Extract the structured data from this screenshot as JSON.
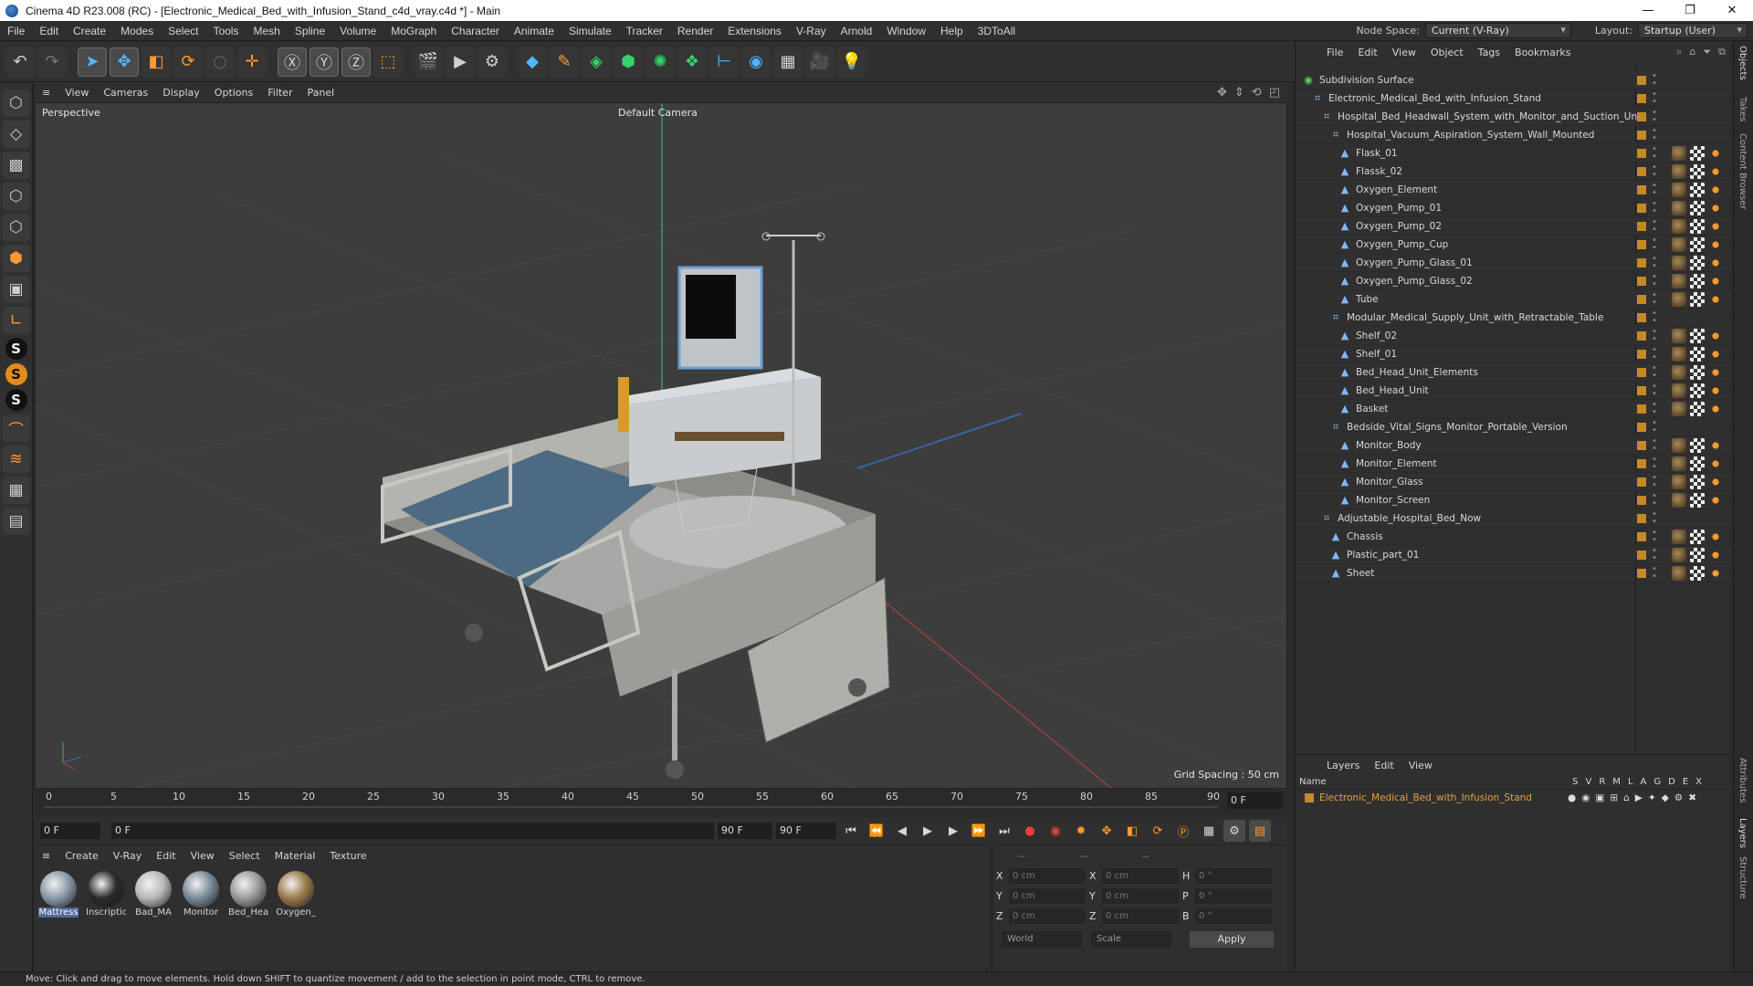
{
  "window": {
    "title": "Cinema 4D R23.008 (RC) - [Electronic_Medical_Bed_with_Infusion_Stand_c4d_vray.c4d *] - Main",
    "controls": [
      "—",
      "❐",
      "✕"
    ]
  },
  "menubar": {
    "items": [
      "File",
      "Edit",
      "Create",
      "Modes",
      "Select",
      "Tools",
      "Mesh",
      "Spline",
      "Volume",
      "MoGraph",
      "Character",
      "Animate",
      "Simulate",
      "Tracker",
      "Render",
      "Extensions",
      "V-Ray",
      "Arnold",
      "Window",
      "Help",
      "3DToAll"
    ],
    "node_space_label": "Node Space:",
    "node_space_value": "Current (V-Ray)",
    "layout_label": "Layout:",
    "layout_value": "Startup (User)"
  },
  "viewport": {
    "menu": [
      "View",
      "Cameras",
      "Display",
      "Options",
      "Filter",
      "Panel"
    ],
    "label": "Perspective",
    "camera": "Default Camera",
    "grid_spacing": "Grid Spacing : 50 cm"
  },
  "timeline": {
    "ticks": [
      "0",
      "5",
      "10",
      "15",
      "20",
      "25",
      "30",
      "35",
      "40",
      "45",
      "50",
      "55",
      "60",
      "65",
      "70",
      "75",
      "80",
      "85",
      "90"
    ],
    "current_frame": "0 F"
  },
  "transport": {
    "start": "0 F",
    "range_start": "0 F",
    "range_end": "90 F",
    "end": "90 F"
  },
  "materials": {
    "menu": [
      "Create",
      "V-Ray",
      "Edit",
      "View",
      "Select",
      "Material",
      "Texture"
    ],
    "items": [
      {
        "name": "Mattress",
        "color": "#8a9aa8"
      },
      {
        "name": "Inscriptio",
        "color": "#2a2a2a"
      },
      {
        "name": "Bad_MA",
        "color": "#b8b8b8"
      },
      {
        "name": "Monitor",
        "color": "#7a8a96"
      },
      {
        "name": "Bed_Hea",
        "color": "#9a9a9a"
      },
      {
        "name": "Oxygen_",
        "color": "#9a7a4a"
      }
    ]
  },
  "attributes": {
    "headers": [
      "--",
      "--",
      "--"
    ],
    "rows": [
      {
        "a": "X",
        "av": "0 cm",
        "b": "X",
        "bv": "0 cm",
        "c": "H",
        "cv": "0 °"
      },
      {
        "a": "Y",
        "av": "0 cm",
        "b": "Y",
        "bv": "0 cm",
        "c": "P",
        "cv": "0 °"
      },
      {
        "a": "Z",
        "av": "0 cm",
        "b": "Z",
        "bv": "0 cm",
        "c": "B",
        "cv": "0 °"
      }
    ],
    "coord_mode": "World",
    "scale_mode": "Scale",
    "apply": "Apply"
  },
  "objects": {
    "menu": [
      "File",
      "Edit",
      "View",
      "Object",
      "Tags",
      "Bookmarks"
    ],
    "tree": [
      {
        "name": "Subdivision Surface",
        "level": 0,
        "icon": "sds"
      },
      {
        "name": "Electronic_Medical_Bed_with_Infusion_Stand",
        "level": 1,
        "icon": "null"
      },
      {
        "name": "Hospital_Bed_Headwall_System_with_Monitor_and_Suction_Unit",
        "level": 2,
        "icon": "null"
      },
      {
        "name": "Hospital_Vacuum_Aspiration_System_Wall_Mounted",
        "level": 3,
        "icon": "null"
      },
      {
        "name": "Flask_01",
        "level": 4,
        "icon": "poly",
        "tags": true
      },
      {
        "name": "Flassk_02",
        "level": 4,
        "icon": "poly",
        "tags": true
      },
      {
        "name": "Oxygen_Element",
        "level": 4,
        "icon": "poly",
        "tags": true
      },
      {
        "name": "Oxygen_Pump_01",
        "level": 4,
        "icon": "poly",
        "tags": true
      },
      {
        "name": "Oxygen_Pump_02",
        "level": 4,
        "icon": "poly",
        "tags": true
      },
      {
        "name": "Oxygen_Pump_Cup",
        "level": 4,
        "icon": "poly",
        "tags": true
      },
      {
        "name": "Oxygen_Pump_Glass_01",
        "level": 4,
        "icon": "poly",
        "tags": true
      },
      {
        "name": "Oxygen_Pump_Glass_02",
        "level": 4,
        "icon": "poly",
        "tags": true
      },
      {
        "name": "Tube",
        "level": 4,
        "icon": "poly",
        "tags": true
      },
      {
        "name": "Modular_Medical_Supply_Unit_with_Retractable_Table",
        "level": 3,
        "icon": "null"
      },
      {
        "name": "Shelf_02",
        "level": 4,
        "icon": "poly",
        "tags": true
      },
      {
        "name": "Shelf_01",
        "level": 4,
        "icon": "poly",
        "tags": true
      },
      {
        "name": "Bed_Head_Unit_Elements",
        "level": 4,
        "icon": "poly",
        "tags": true
      },
      {
        "name": "Bed_Head_Unit",
        "level": 4,
        "icon": "poly",
        "tags": true
      },
      {
        "name": "Basket",
        "level": 4,
        "icon": "poly",
        "tags": true
      },
      {
        "name": "Bedside_Vital_Signs_Monitor_Portable_Version",
        "level": 3,
        "icon": "null"
      },
      {
        "name": "Monitor_Body",
        "level": 4,
        "icon": "poly",
        "tags": true
      },
      {
        "name": "Monitor_Element",
        "level": 4,
        "icon": "poly",
        "tags": true
      },
      {
        "name": "Monitor_Glass",
        "level": 4,
        "icon": "poly",
        "tags": true
      },
      {
        "name": "Monitor_Screen",
        "level": 4,
        "icon": "poly",
        "tags": true
      },
      {
        "name": "Adjustable_Hospital_Bed_Now",
        "level": 2,
        "icon": "null"
      },
      {
        "name": "Chassis",
        "level": 3,
        "icon": "poly",
        "tags": true
      },
      {
        "name": "Plastic_part_01",
        "level": 3,
        "icon": "poly",
        "tags": true
      },
      {
        "name": "Sheet",
        "level": 3,
        "icon": "poly",
        "tags": true
      }
    ]
  },
  "layers": {
    "menu": [
      "Layers",
      "Edit",
      "View"
    ],
    "name_header": "Name",
    "columns": [
      "S",
      "V",
      "R",
      "M",
      "L",
      "A",
      "G",
      "D",
      "E",
      "X"
    ],
    "items": [
      "Electronic_Medical_Bed_with_Infusion_Stand"
    ]
  },
  "right_tabs": [
    "Objects",
    "Takes",
    "Content Browser",
    "Attributes",
    "Layers",
    "Structure"
  ],
  "status": "Move: Click and drag to move elements. Hold down SHIFT to quantize movement / add to the selection in point mode, CTRL to remove."
}
